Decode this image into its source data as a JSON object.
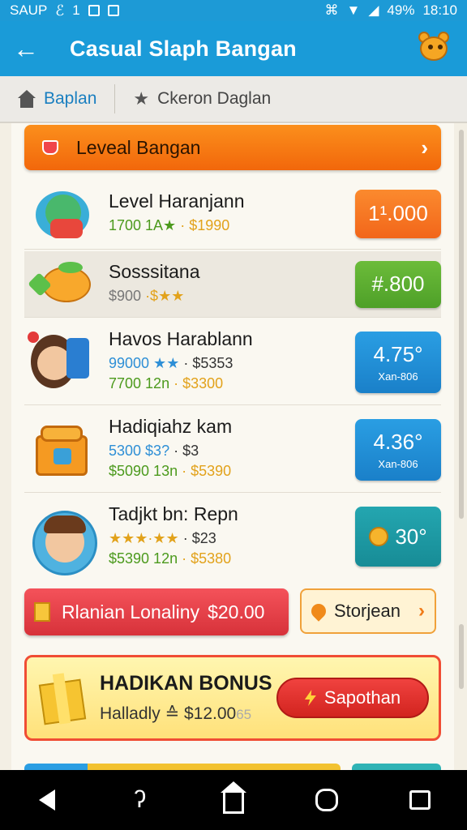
{
  "status_bar": {
    "left_text": "SAUP",
    "left_icon_1": "link-icon",
    "left_text_2": "1",
    "battery": "49%",
    "time": "18:10"
  },
  "app_bar": {
    "title": "Casual Slaph Bangan",
    "back_icon": "arrow-left-icon",
    "mascot_icon": "mascot-icon"
  },
  "tabs": [
    {
      "label": "Baplan",
      "icon": "house-icon",
      "active": true
    },
    {
      "label": "Ckeron Daglan",
      "icon": "star-icon",
      "active": false
    }
  ],
  "header_banner": {
    "label": "Leveal Bangan",
    "icon": "gift-box-icon"
  },
  "items": [
    {
      "title": "Level Haranjann",
      "line1a": "1700 1A★",
      "line1b": "· $1990",
      "line2a": "",
      "line2b": "",
      "btn_main": "1¹.000",
      "btn_sub": "",
      "btn_color": "#f27020"
    },
    {
      "title": "Sosssitana",
      "line1a": "$900",
      "line1b": "·$★★",
      "line2a": "",
      "line2b": "",
      "btn_main": "#.800",
      "btn_sub": "",
      "btn_color": "#56a82e"
    },
    {
      "title": "Havos Harablann",
      "line1a": "99000 ★★",
      "line1b": "· $5353",
      "line2a": "7700 12n",
      "line2b": "· $3300",
      "btn_main": "4.75°",
      "btn_sub": "Xan-806",
      "btn_color": "#1e89d1"
    },
    {
      "title": "Hadiqiahz kam",
      "line1a": "5300 $3?",
      "line1b": "· $3",
      "line2a": "$5090 13n",
      "line2b": "· $5390",
      "btn_main": "4.36°",
      "btn_sub": "Xan-806",
      "btn_color": "#1e89d1"
    },
    {
      "title": "Tadjkt bn: Repn",
      "line1a": "★★★·★★",
      "line1b": "· $23",
      "line2a": "$5390 12n",
      "line2b": "· $5380",
      "btn_main": "30°",
      "btn_sub": "",
      "btn_color": "#1d96a1"
    }
  ],
  "cta_primary": {
    "label": "Rlanian Lonaliny",
    "price": "$20.00"
  },
  "cta_secondary": {
    "label": "Storjean"
  },
  "bonus": {
    "heading": "HADIKAN BONUS",
    "sub": "Halladly ≙ $12.00",
    "sub_tail": "65",
    "button": "Sapothan"
  },
  "nav": [
    "back-icon",
    "search-icon",
    "home-icon",
    "puzzle-icon",
    "recents-icon"
  ]
}
